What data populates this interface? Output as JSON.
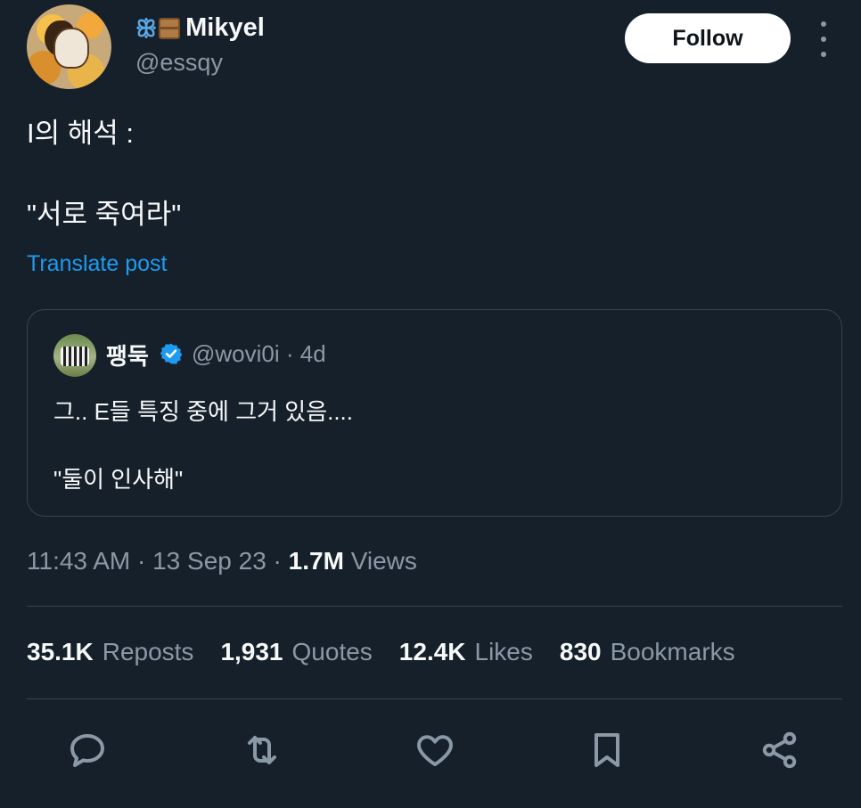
{
  "author": {
    "name_emojis": [
      "butterfly-icon",
      "package-icon"
    ],
    "name": "Mikyel",
    "handle": "@essqy"
  },
  "follow_label": "Follow",
  "tweet": {
    "line1": "I의 해석 :",
    "line2": "\"서로 죽여라\"",
    "translate_label": "Translate post"
  },
  "quoted_tweet": {
    "name": "팽둑",
    "handle_time": "@wovi0i · 4d",
    "line1": "그.. E들 특징 중에 그거 있음....",
    "line2": "\"둘이 인사해\""
  },
  "meta": {
    "time_date": "11:43 AM · 13 Sep 23 · ",
    "views_count": "1.7M",
    "views_label": " Views"
  },
  "stats": {
    "reposts_count": "35.1K",
    "reposts_label": "Reposts",
    "quotes_count": "1,931",
    "quotes_label": "Quotes",
    "likes_count": "12.4K",
    "likes_label": "Likes",
    "bookmarks_count": "830",
    "bookmarks_label": "Bookmarks"
  },
  "colors": {
    "background": "#15202b",
    "text": "#f7f9f9",
    "muted": "#8b98a5",
    "accent": "#1d9bf0",
    "border": "#38444d"
  },
  "actions": [
    "reply-icon",
    "repost-icon",
    "like-icon",
    "bookmark-icon",
    "share-icon"
  ]
}
